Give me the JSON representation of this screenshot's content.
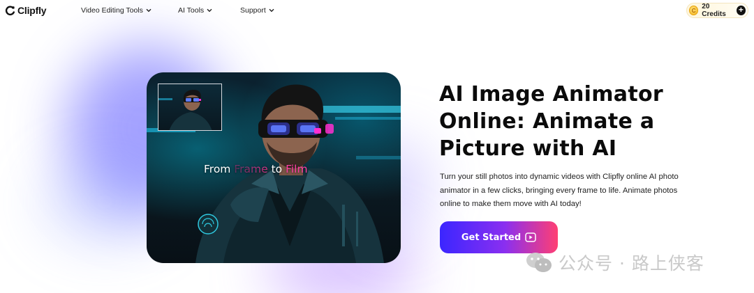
{
  "header": {
    "logo_text": "Clipfly",
    "nav": [
      {
        "label": "Video Editing Tools",
        "icon": "chevron-down-icon"
      },
      {
        "label": "AI Tools",
        "icon": "chevron-down-icon"
      },
      {
        "label": "Support",
        "icon": "chevron-down-icon"
      }
    ],
    "credits": {
      "coin_symbol": "C",
      "label": "20 Credits",
      "add_symbol": "+"
    }
  },
  "hero": {
    "caption": {
      "part1": "From ",
      "highlight1": "Frame",
      "part2": " to ",
      "highlight2": "Film"
    }
  },
  "main": {
    "title": "AI Image Animator Online: Animate a Picture with AI",
    "description": "Turn your still photos into dynamic videos with Clipfly online AI photo animator in a few clicks, bringing every frame to life. Animate photos online to make them move with AI today!",
    "cta_label": "Get Started",
    "cta_icon": "play-icon"
  },
  "watermark": {
    "icon": "wechat-icon",
    "text": "公众号 · 路上侠客"
  },
  "colors": {
    "accent_start": "#3b26ff",
    "accent_end": "#ff3f73",
    "caption_highlight": "#ff3fa5",
    "goggle_glow": "#ff2fd0"
  }
}
